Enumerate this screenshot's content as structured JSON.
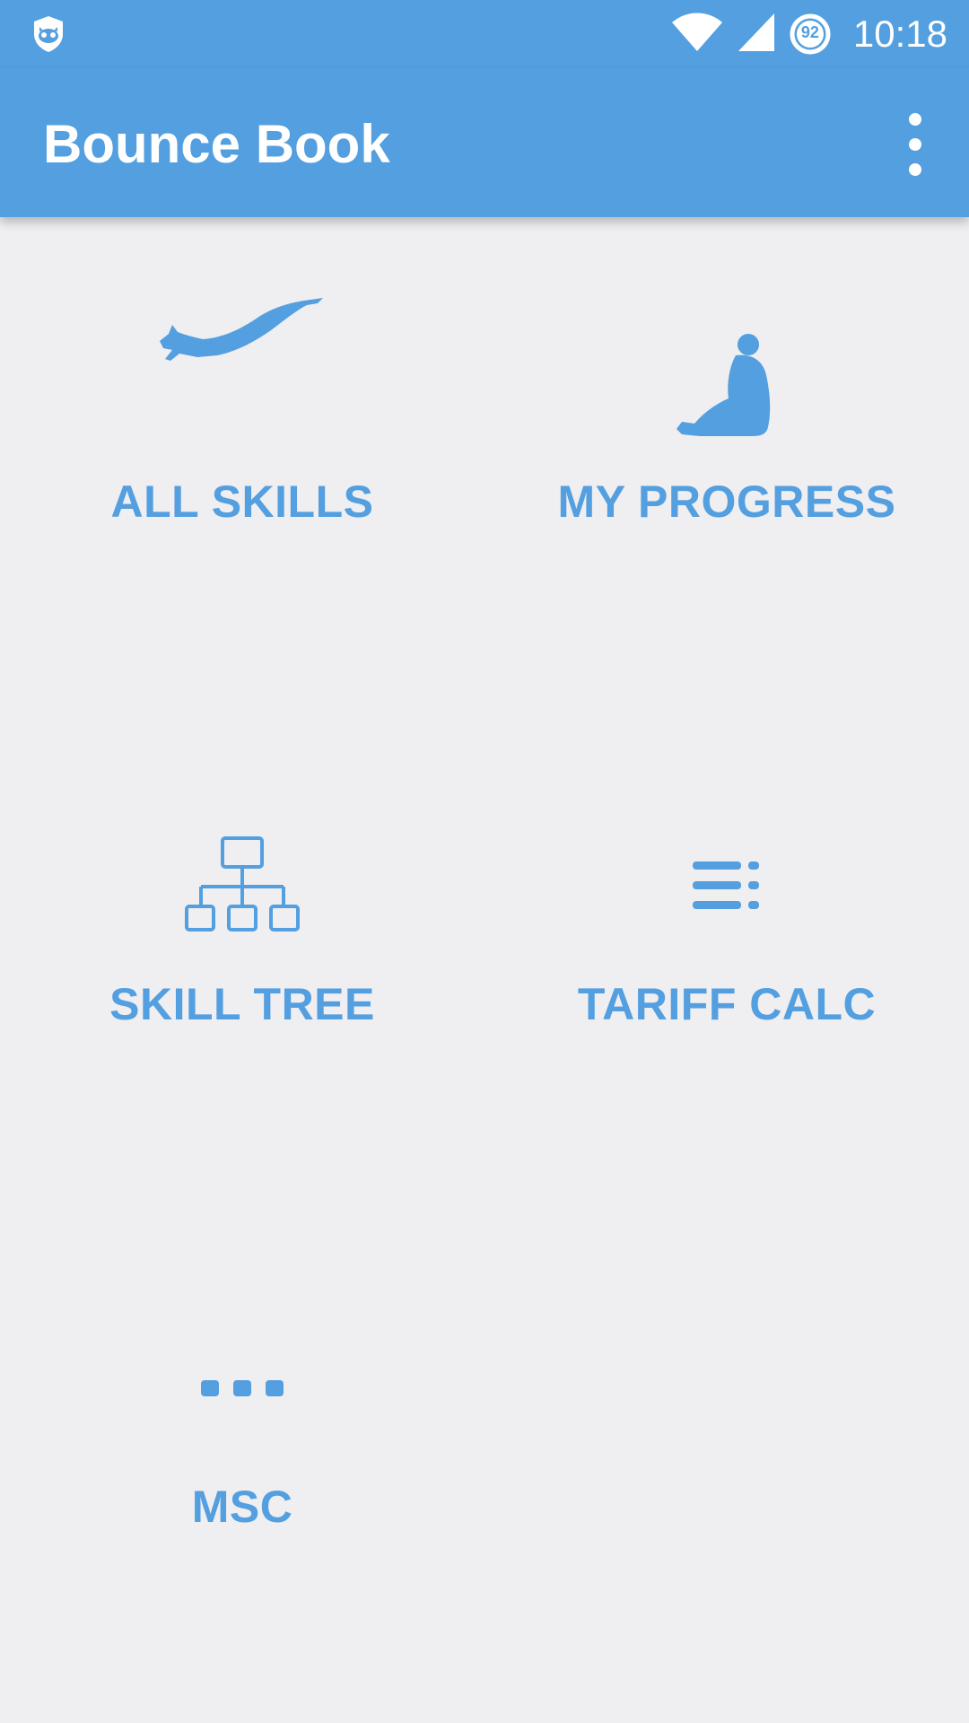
{
  "status_bar": {
    "time": "10:18",
    "battery_level": "92",
    "icons": [
      "shield-cat-icon",
      "wifi-icon",
      "cell-signal-icon",
      "battery-icon"
    ]
  },
  "app_bar": {
    "title": "Bounce Book",
    "menu_icon": "more-vert-icon"
  },
  "tiles": [
    {
      "label": "ALL SKILLS",
      "icon": "diving-person-icon"
    },
    {
      "label": "MY PROGRESS",
      "icon": "sitting-person-icon"
    },
    {
      "label": "SKILL TREE",
      "icon": "hierarchy-icon"
    },
    {
      "label": "TARIFF CALC",
      "icon": "list-lines-icon"
    },
    {
      "label": "MSC",
      "icon": "more-horiz-icon"
    }
  ],
  "colors": {
    "primary": "#539fe0",
    "background": "#efeef0"
  }
}
